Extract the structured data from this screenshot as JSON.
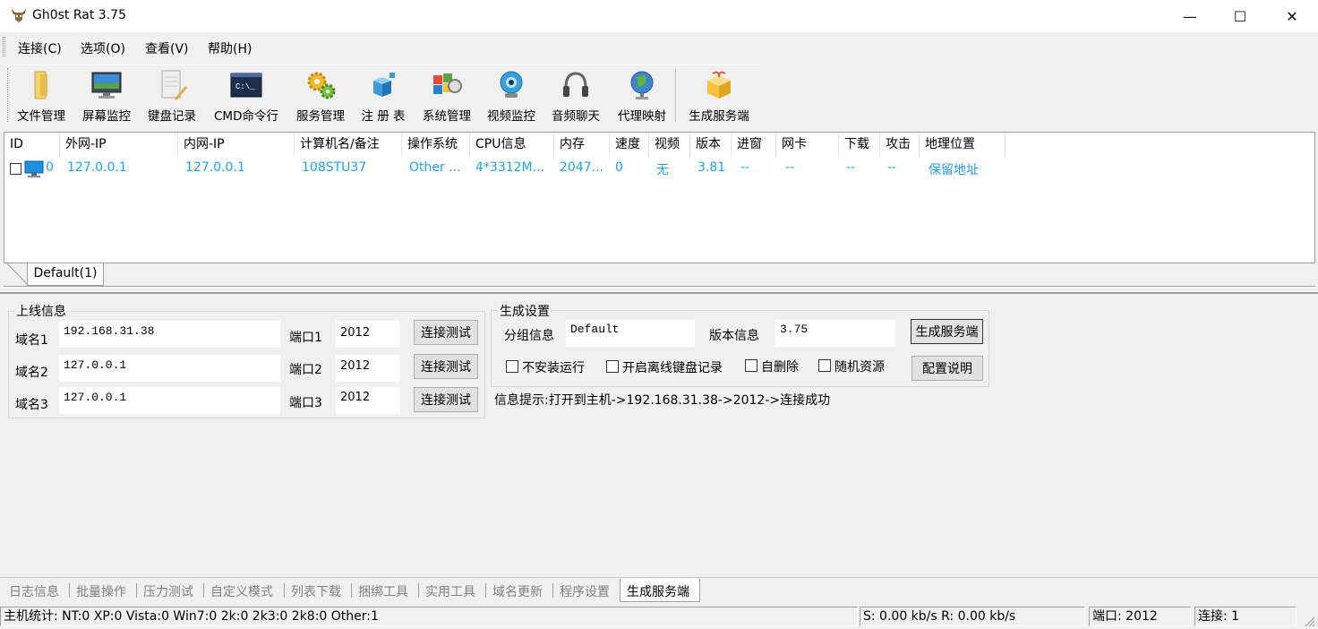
{
  "window": {
    "title": "Gh0st Rat 3.75",
    "minimize_glyph": "—",
    "maximize_glyph": "☐",
    "close_glyph": "✕"
  },
  "menu": [
    "连接(C)",
    "选项(O)",
    "查看(V)",
    "帮助(H)"
  ],
  "toolbar": [
    {
      "label": "文件管理",
      "icon": "folder-icon"
    },
    {
      "label": "屏幕监控",
      "icon": "monitor-icon"
    },
    {
      "label": "键盘记录",
      "icon": "notepad-icon"
    },
    {
      "label": "CMD命令行",
      "icon": "terminal-icon"
    },
    {
      "label": "服务管理",
      "icon": "gears-icon"
    },
    {
      "label": "注 册 表",
      "icon": "registry-icon"
    },
    {
      "label": "系统管理",
      "icon": "system-icon"
    },
    {
      "label": "视频监控",
      "icon": "webcam-icon"
    },
    {
      "label": "音频聊天",
      "icon": "headset-icon"
    },
    {
      "label": "代理映射",
      "icon": "globe-icon"
    },
    {
      "label": "生成服务端",
      "icon": "package-icon"
    }
  ],
  "list": {
    "columns": [
      "ID",
      "外网-IP",
      "内网-IP",
      "计算机名/备注",
      "操作系统",
      "CPU信息",
      "内存",
      "速度",
      "视频",
      "版本",
      "进窗",
      "网卡",
      "下载",
      "攻击",
      "地理位置"
    ],
    "rows": [
      [
        "0",
        "127.0.0.1",
        "127.0.0.1",
        "108STU37",
        "Other ...",
        "4*3312M...",
        "2047...",
        "0",
        "无",
        "3.81",
        "--",
        "--",
        "--",
        "--",
        "保留地址"
      ]
    ]
  },
  "group_tab": "Default(1)",
  "online_info": {
    "title": "上线信息",
    "rows": [
      {
        "domain_label": "域名1",
        "domain": "192.168.31.38",
        "port_label": "端口1",
        "port": "2012",
        "test": "连接测试"
      },
      {
        "domain_label": "域名2",
        "domain": "127.0.0.1",
        "port_label": "端口2",
        "port": "2012",
        "test": "连接测试"
      },
      {
        "domain_label": "域名3",
        "domain": "127.0.0.1",
        "port_label": "端口3",
        "port": "2012",
        "test": "连接测试"
      }
    ]
  },
  "build_settings": {
    "title": "生成设置",
    "group_label": "分组信息",
    "group_value": "Default",
    "version_label": "版本信息",
    "version_value": "3.75",
    "build_button": "生成服务端",
    "config_button": "配置说明",
    "checkboxes": [
      "不安装运行",
      "开启离线键盘记录",
      "自删除",
      "随机资源"
    ]
  },
  "info_hint": "信息提示:打开到主机->192.168.31.38->2012->连接成功",
  "bottom_tabs": [
    "日志信息",
    "批量操作",
    "压力测试",
    "自定义模式",
    "列表下载",
    "捆绑工具",
    "实用工具",
    "域名更新",
    "程序设置",
    "生成服务端"
  ],
  "status": {
    "hosts": "主机统计:  NT:0  XP:0  Vista:0  Win7:0  2k:0  2k3:0  2k8:0  Other:1",
    "speed": "S: 0.00 kb/s R: 0.00 kb/s",
    "port": "端口: 2012",
    "connections": "连接: 1"
  }
}
